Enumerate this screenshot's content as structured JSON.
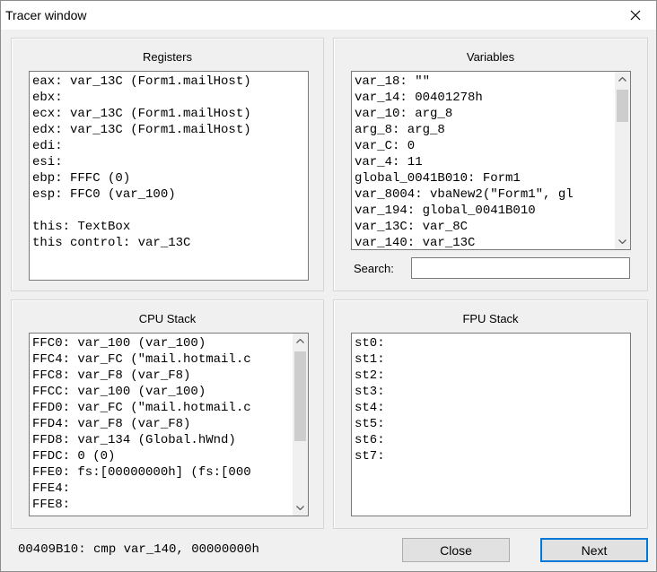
{
  "window": {
    "title": "Tracer window"
  },
  "registers": {
    "title": "Registers",
    "lines": [
      "eax: var_13C (Form1.mailHost)",
      "ebx:",
      "ecx: var_13C (Form1.mailHost)",
      "edx: var_13C (Form1.mailHost)",
      "edi:",
      "esi:",
      "ebp: FFFC (0)",
      "esp: FFC0 (var_100)",
      "",
      "this: TextBox",
      "this control: var_13C"
    ]
  },
  "variables": {
    "title": "Variables",
    "lines": [
      "var_18: \"\"",
      "var_14: 00401278h",
      "var_10: arg_8",
      "arg_8: arg_8",
      "var_C: 0",
      "var_4: 11",
      "global_0041B010: Form1",
      "var_8004: vbaNew2(\"Form1\", gl",
      "var_194: global_0041B010",
      "var_13C: var_8C",
      "var_140: var_13C"
    ],
    "search_label": "Search:",
    "search_value": ""
  },
  "cpu_stack": {
    "title": "CPU Stack",
    "lines": [
      "FFC0: var_100 (var_100)",
      "FFC4: var_FC (\"mail.hotmail.c",
      "FFC8: var_F8 (var_F8)",
      "FFCC: var_100 (var_100)",
      "FFD0: var_FC (\"mail.hotmail.c",
      "FFD4: var_F8 (var_F8)",
      "FFD8: var_134 (Global.hWnd)",
      "FFDC: 0 (0)",
      "FFE0: fs:[00000000h] (fs:[000",
      "FFE4:",
      "FFE8:"
    ]
  },
  "fpu_stack": {
    "title": "FPU Stack",
    "lines": [
      "st0:",
      "st1:",
      "st2:",
      "st3:",
      "st4:",
      "st5:",
      "st6:",
      "st7:"
    ]
  },
  "status_text": "00409B10: cmp var_140, 00000000h",
  "buttons": {
    "close": "Close",
    "next": "Next"
  },
  "icons": {
    "close": "close-icon",
    "scroll_up": "scroll-up-arrow-icon",
    "scroll_down": "scroll-down-arrow-icon"
  },
  "colors": {
    "default_button_border": "#0078d7",
    "panel_background": "#f0f0f0"
  }
}
